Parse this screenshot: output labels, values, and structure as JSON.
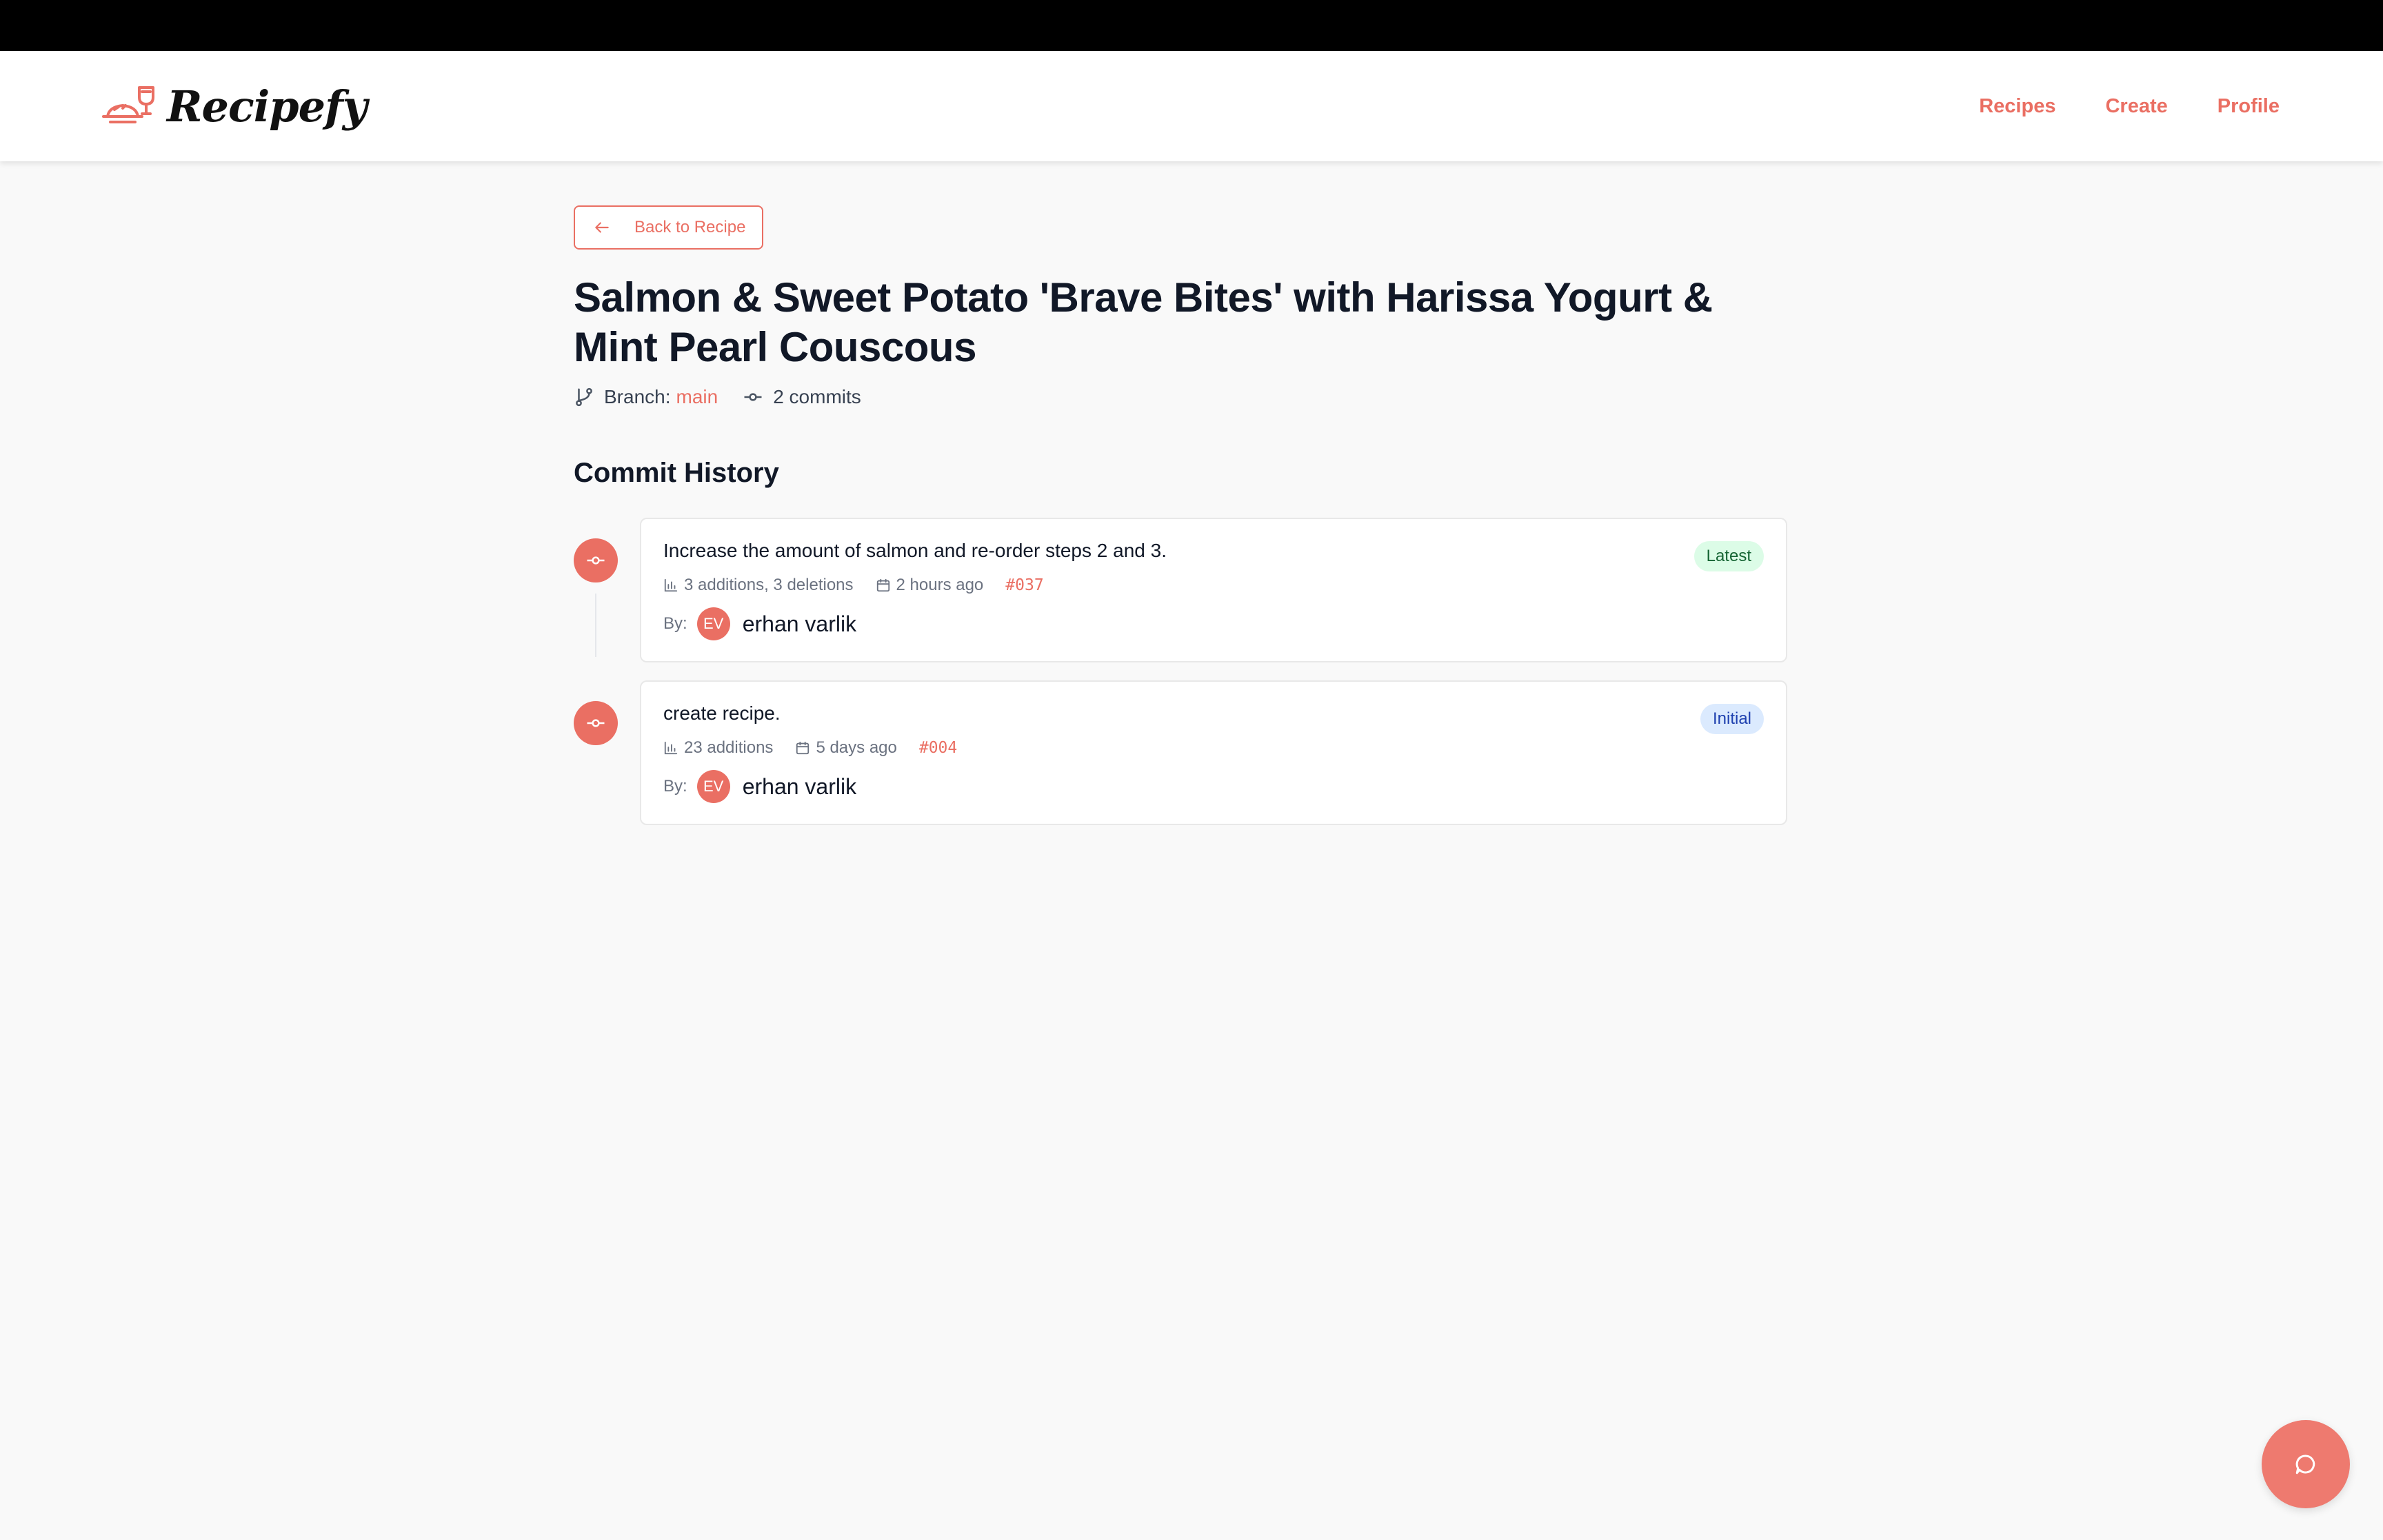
{
  "app": {
    "name": "Recipefy"
  },
  "nav": {
    "items": [
      "Recipes",
      "Create",
      "Profile"
    ]
  },
  "page": {
    "back_label": "Back to Recipe",
    "title": "Salmon & Sweet Potato 'Brave Bites' with Harissa Yogurt & Mint Pearl Couscous",
    "branch_label": "Branch:",
    "branch_value": "main",
    "commit_count": "2 commits",
    "section_title": "Commit History"
  },
  "commits": [
    {
      "message": "Increase the amount of salmon and re-order steps 2 and 3.",
      "badge": "Latest",
      "stats": "3 additions, 3 deletions",
      "time": "2 hours ago",
      "hash": "#037",
      "by_label": "By:",
      "avatar": "EV",
      "author": "erhan varlik"
    },
    {
      "message": "create recipe.",
      "badge": "Initial",
      "stats": "23 additions",
      "time": "5 days ago",
      "hash": "#004",
      "by_label": "By:",
      "avatar": "EV",
      "author": "erhan varlik"
    }
  ],
  "colors": {
    "accent": "#ea6f63",
    "latest_bg": "#dcfce7",
    "initial_bg": "#dbeafe"
  },
  "icons": [
    "recipefy-logo-icon",
    "arrow-left-icon",
    "git-branch-icon",
    "git-commit-icon",
    "bar-chart-icon",
    "calendar-icon",
    "chat-icon"
  ]
}
